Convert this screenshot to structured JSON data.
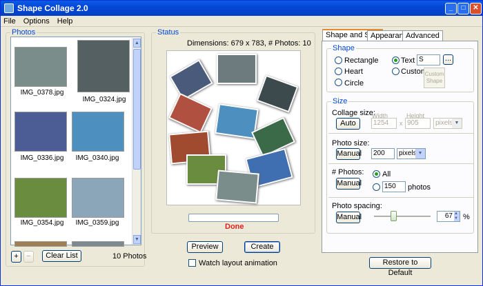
{
  "window": {
    "title": "Shape Collage 2.0"
  },
  "menu": [
    "File",
    "Options",
    "Help"
  ],
  "photos": {
    "group_label": "Photos",
    "items": [
      {
        "name": "IMG_0378.jpg",
        "color": "#7a8d8b"
      },
      {
        "name": "IMG_0324.jpg",
        "color": "#556063"
      },
      {
        "name": "IMG_0336.jpg",
        "color": "#4c5c95"
      },
      {
        "name": "IMG_0340.jpg",
        "color": "#4d8fbf"
      },
      {
        "name": "IMG_0354.jpg",
        "color": "#6a8c3e"
      },
      {
        "name": "IMG_0359.jpg",
        "color": "#8aa6b8"
      }
    ],
    "add_label": "+",
    "remove_label": "−",
    "clear_label": "Clear List",
    "count": "10 Photos"
  },
  "status": {
    "group_label": "Status",
    "dimensions": "Dimensions: 679 x 783, # Photos: 10",
    "state": "Done",
    "preview_label": "Preview",
    "create_label": "Create",
    "watch_label": "Watch layout animation"
  },
  "tabs": [
    "Shape and Size",
    "Appearance",
    "Advanced"
  ],
  "shape": {
    "group_label": "Shape",
    "rectangle": "Rectangle",
    "heart": "Heart",
    "circle": "Circle",
    "text": "Text",
    "text_value": "S",
    "browse": "...",
    "custom": "Custom",
    "custom_shape": "Custom Shape"
  },
  "size": {
    "group_label": "Size",
    "collage_size": "Collage size:",
    "auto_label": "Auto",
    "width_label": "Width",
    "height_label": "Height",
    "width_value": "1254",
    "x_label": "x",
    "height_value": "905",
    "unit_dis": "pixels",
    "photo_size": "Photo size:",
    "manual": "Manual",
    "photo_size_value": "200",
    "photo_unit": "pixels",
    "num_photos": "# Photos:",
    "all_label": "All",
    "num_value": "150",
    "photos_label": "photos",
    "spacing": "Photo spacing:",
    "spacing_value": "67",
    "percent": "%"
  },
  "restore_label": "Restore to Default",
  "colors": {
    "accent": "#0046d5",
    "done": "#e02020"
  }
}
